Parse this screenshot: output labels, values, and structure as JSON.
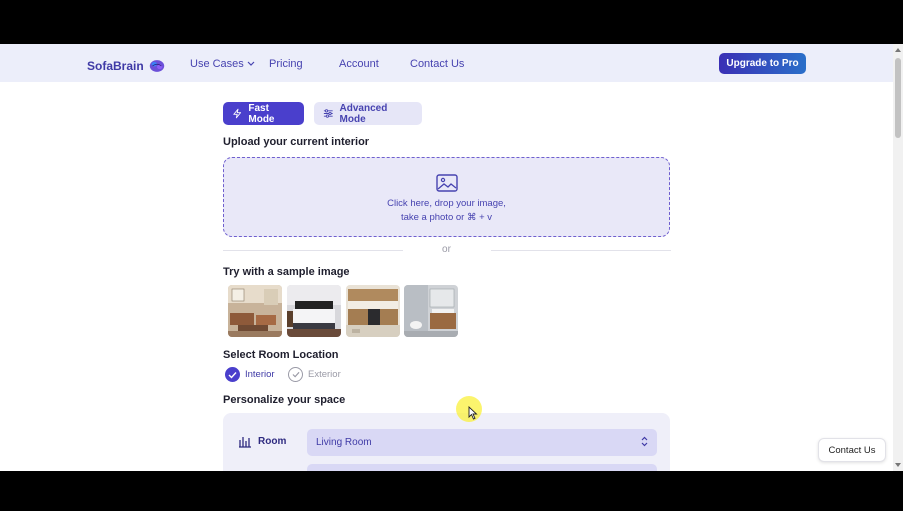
{
  "header": {
    "brand": "SofaBrain",
    "nav": [
      "Use Cases",
      "Pricing",
      "Account",
      "Contact Us"
    ],
    "upgrade_label": "Upgrade to Pro"
  },
  "modes": {
    "fast": "Fast Mode",
    "advanced": "Advanced Mode",
    "active": "Fast Mode"
  },
  "upload": {
    "title": "Upload your current interior",
    "line1": "Click here, drop your image,",
    "line2": "take a photo or ⌘ + v",
    "or": "or"
  },
  "samples": {
    "title": "Try with a sample image",
    "images": [
      "living-room",
      "bedroom",
      "kitchen",
      "bathroom"
    ]
  },
  "location": {
    "title": "Select Room Location",
    "options": [
      "Interior",
      "Exterior"
    ],
    "selected": "Interior"
  },
  "personalize": {
    "title": "Personalize your space",
    "room_label": "Room",
    "room_value": "Living Room"
  },
  "contact_float": "Contact Us",
  "colors": {
    "accent": "#4a3fcc",
    "header_bg": "#eceefa"
  }
}
